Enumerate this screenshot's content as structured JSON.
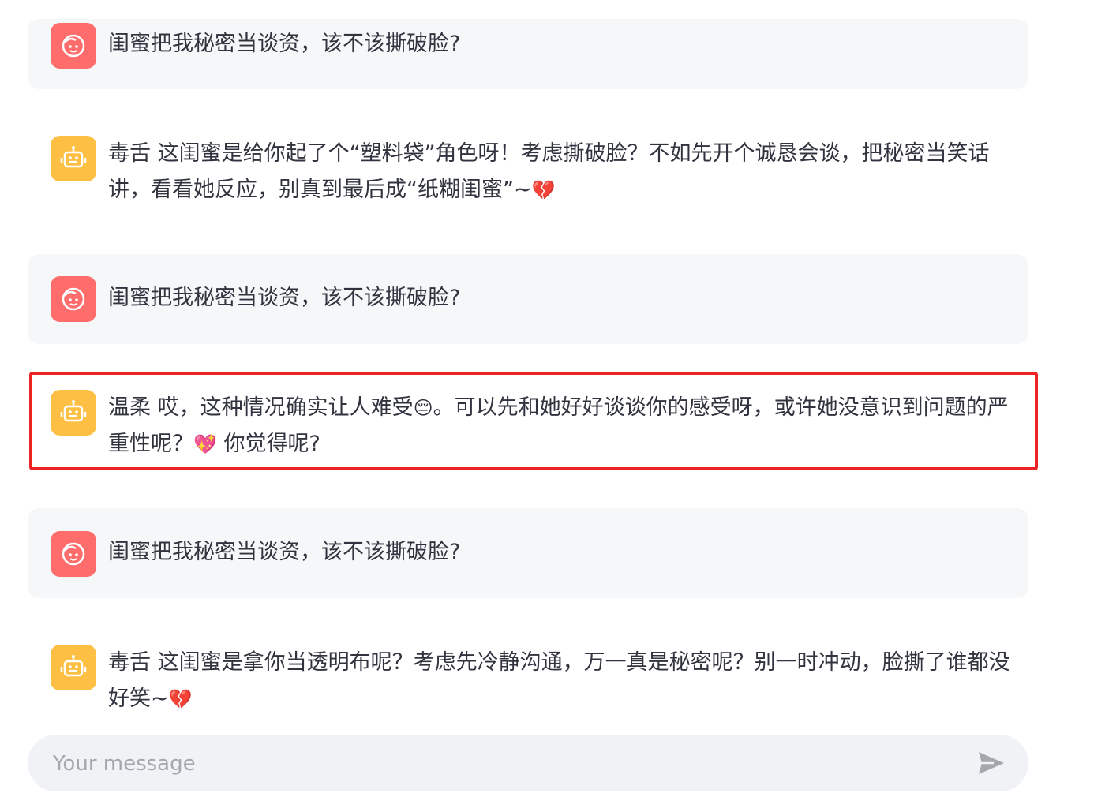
{
  "messages": [
    {
      "role": "user",
      "text": "闺蜜把我秘密当谈资，该不该撕破脸?"
    },
    {
      "role": "assistant",
      "text": "毒舌 这闺蜜是给你起了个“塑料袋”角色呀！考虑撕破脸？不如先开个诚恳会谈，把秘密当笑话讲，看看她反应，别真到最后成“纸糊闺蜜”~",
      "emoji_end": "💔"
    },
    {
      "role": "user",
      "text": "闺蜜把我秘密当谈资，该不该撕破脸?"
    },
    {
      "role": "assistant",
      "text_a": "温柔 哎，这种情况确实让人难受",
      "emoji_a": "😔",
      "text_b": "。可以先和她好好谈谈你的感受呀，或许她没意识到问题的严重性呢？",
      "emoji_b": "💖",
      "text_c": " 你觉得呢?"
    },
    {
      "role": "user",
      "text": "闺蜜把我秘密当谈资，该不该撕破脸?"
    },
    {
      "role": "assistant",
      "text": "毒舌 这闺蜜是拿你当透明布呢？考虑先冷静沟通，万一真是秘密呢？别一时冲动，脸撕了谁都没好笑~",
      "emoji_end": "💔"
    }
  ],
  "input": {
    "placeholder": "Your message",
    "value": ""
  },
  "icons": {
    "user_avatar": "smiley-face-icon",
    "assistant_avatar": "robot-icon",
    "send": "send-icon"
  },
  "colors": {
    "user_avatar_bg": "#fe6d6b",
    "assistant_avatar_bg": "#fec044",
    "user_bubble_bg": "#f6f7f9",
    "highlight_border": "#ee2222",
    "input_bg": "#f0f2f6"
  }
}
